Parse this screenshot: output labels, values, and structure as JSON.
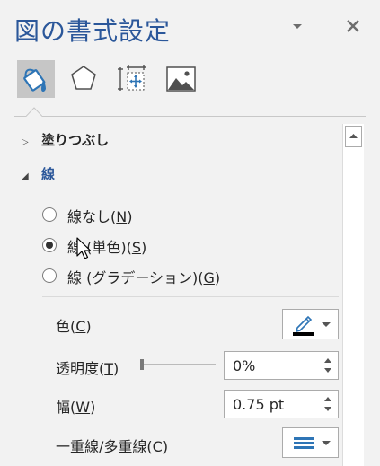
{
  "pane": {
    "title": "図の書式設定",
    "dropdown_icon": "chevron-down-icon",
    "close_icon": "close-icon"
  },
  "tabs": [
    {
      "name": "fill-line",
      "icon": "paint-bucket-icon",
      "selected": true
    },
    {
      "name": "effects",
      "icon": "pentagon-icon",
      "selected": false
    },
    {
      "name": "size-properties",
      "icon": "size-position-icon",
      "selected": false
    },
    {
      "name": "picture",
      "icon": "picture-icon",
      "selected": false
    }
  ],
  "sections": {
    "fill": {
      "label": "塗りつぶし",
      "expanded": false
    },
    "line": {
      "label": "線",
      "expanded": true
    }
  },
  "line_options": {
    "none": {
      "label": "線なし(",
      "key": "N",
      "suffix": ")",
      "selected": false
    },
    "solid": {
      "label": "線 (単色)(",
      "key": "S",
      "suffix": ")",
      "selected": true
    },
    "gradient": {
      "label": "線 (グラデーション)(",
      "key": "G",
      "suffix": ")",
      "selected": false
    }
  },
  "properties": {
    "color": {
      "label": "色(",
      "key": "C",
      "suffix": ")",
      "swatch": "#000000"
    },
    "transparency": {
      "label": "透明度(",
      "key": "T",
      "suffix": ")",
      "value": "0%",
      "slider_fraction": 0
    },
    "width": {
      "label": "幅(",
      "key": "W",
      "suffix": ")",
      "value": "0.75 pt"
    },
    "compound": {
      "label": "一重線/多重線(",
      "key": "C",
      "suffix": ")"
    }
  },
  "colors": {
    "accent": "#2b579a",
    "background": "#f2f2f2",
    "selected_tab": "#c6c6c6",
    "icon_blue": "#2e75b6"
  }
}
